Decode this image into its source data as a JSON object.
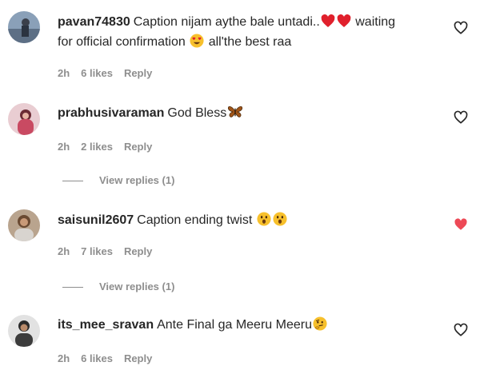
{
  "comments": [
    {
      "username": "pavan74830",
      "text_line1": "Caption nijam aythe bale untadi..",
      "text_after_hearts": "waiting",
      "text_line2_a": "for official confirmation",
      "text_line2_b": "all'the best raa",
      "time": "2h",
      "likes": "6 likes",
      "reply": "Reply",
      "liked": false
    },
    {
      "username": "prabhusivaraman",
      "text": "God Bless",
      "time": "2h",
      "likes": "2 likes",
      "reply": "Reply",
      "view_replies": "View replies (1)",
      "liked": false
    },
    {
      "username": "saisunil2607",
      "text": "Caption ending twist",
      "time": "2h",
      "likes": "7 likes",
      "reply": "Reply",
      "view_replies": "View replies (1)",
      "liked": true
    },
    {
      "username": "its_mee_sravan",
      "text": "Ante Final ga Meeru Meeru",
      "time": "2h",
      "likes": "6 likes",
      "reply": "Reply",
      "liked": false
    }
  ],
  "colors": {
    "text": "#262626",
    "muted": "#8e8e8e",
    "liked_heart": "#ed4956"
  },
  "icons": [
    "heart-outline-icon",
    "heart-filled-icon",
    "red-heart-emoji",
    "heart-eyes-emoji",
    "butterfly-emoji",
    "surprised-emoji",
    "thinking-emoji"
  ]
}
